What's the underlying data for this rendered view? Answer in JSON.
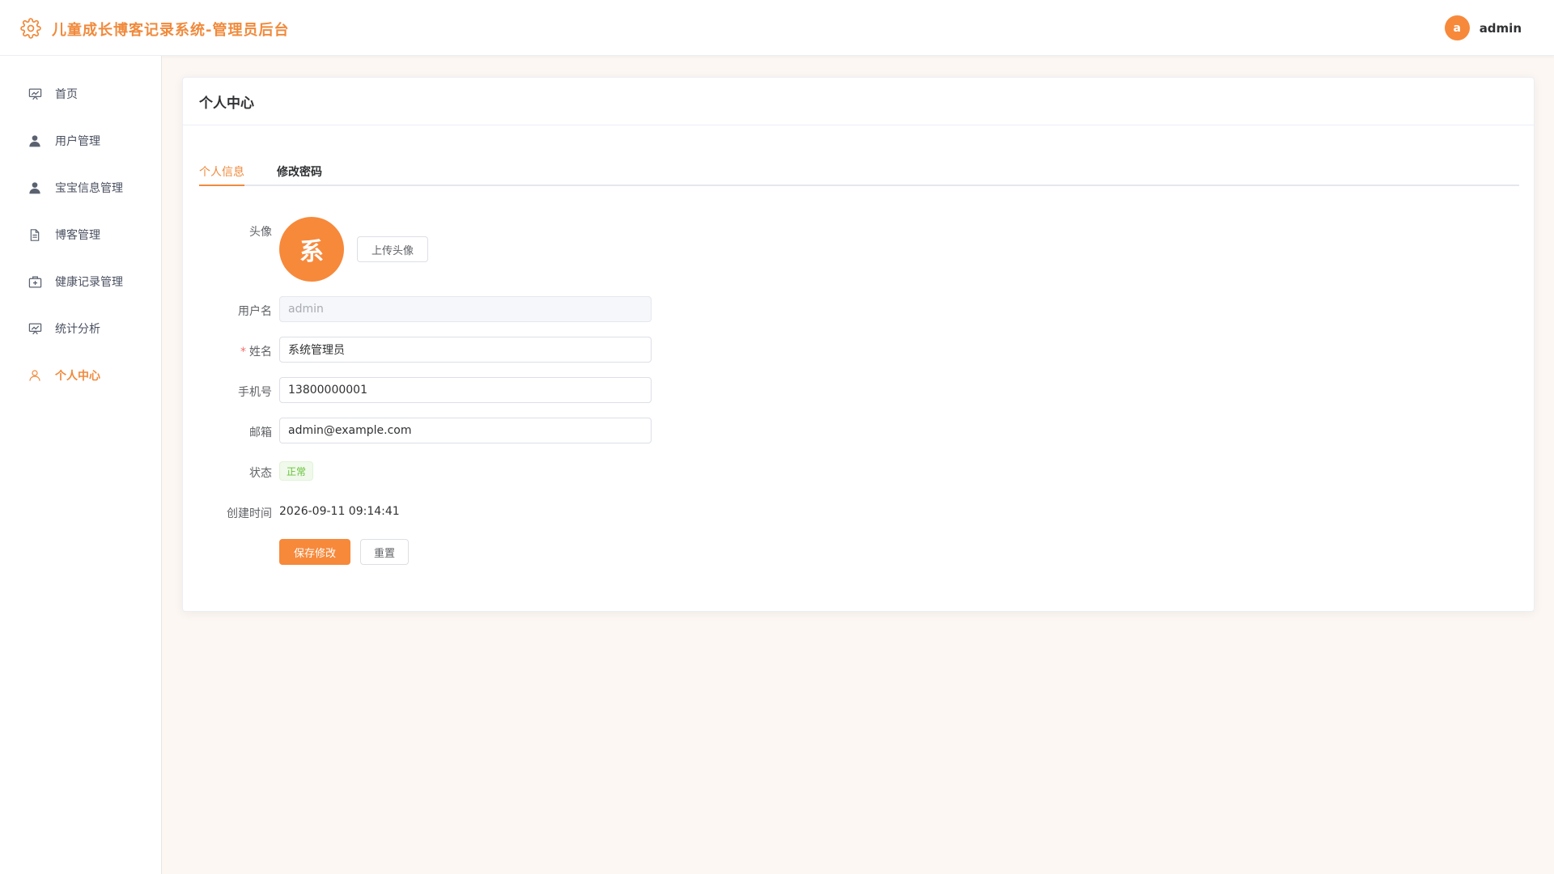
{
  "app": {
    "title": "儿童成长博客记录系统-管理员后台",
    "accent_color": "#f08a3c",
    "logo_icon": "gear-icon"
  },
  "header": {
    "user_initial": "a",
    "user_name": "admin"
  },
  "sidebar": {
    "items": [
      {
        "label": "首页",
        "icon": "presentation-chart-icon",
        "active": false
      },
      {
        "label": "用户管理",
        "icon": "user-icon",
        "active": false
      },
      {
        "label": "宝宝信息管理",
        "icon": "user-icon",
        "active": false
      },
      {
        "label": "博客管理",
        "icon": "document-icon",
        "active": false
      },
      {
        "label": "健康记录管理",
        "icon": "first-aid-kit-icon",
        "active": false
      },
      {
        "label": "统计分析",
        "icon": "presentation-chart-icon",
        "active": false
      },
      {
        "label": "个人中心",
        "icon": "user-outline-icon",
        "active": true
      }
    ]
  },
  "main": {
    "card_title": "个人中心",
    "tabs": [
      {
        "label": "个人信息",
        "active": true
      },
      {
        "label": "修改密码",
        "active": false
      }
    ],
    "form": {
      "avatar_label": "头像",
      "avatar_char": "系",
      "upload_button": "上传头像",
      "username_label": "用户名",
      "username_value": "admin",
      "name_required_mark": "*",
      "name_label": "姓名",
      "name_value": "系统管理员",
      "phone_label": "手机号",
      "phone_value": "13800000001",
      "email_label": "邮箱",
      "email_value": "admin@example.com",
      "status_label": "状态",
      "status_value": "正常",
      "created_label": "创建时间",
      "created_value": "2026-09-11 09:14:41",
      "save_button": "保存修改",
      "reset_button": "重置"
    }
  }
}
